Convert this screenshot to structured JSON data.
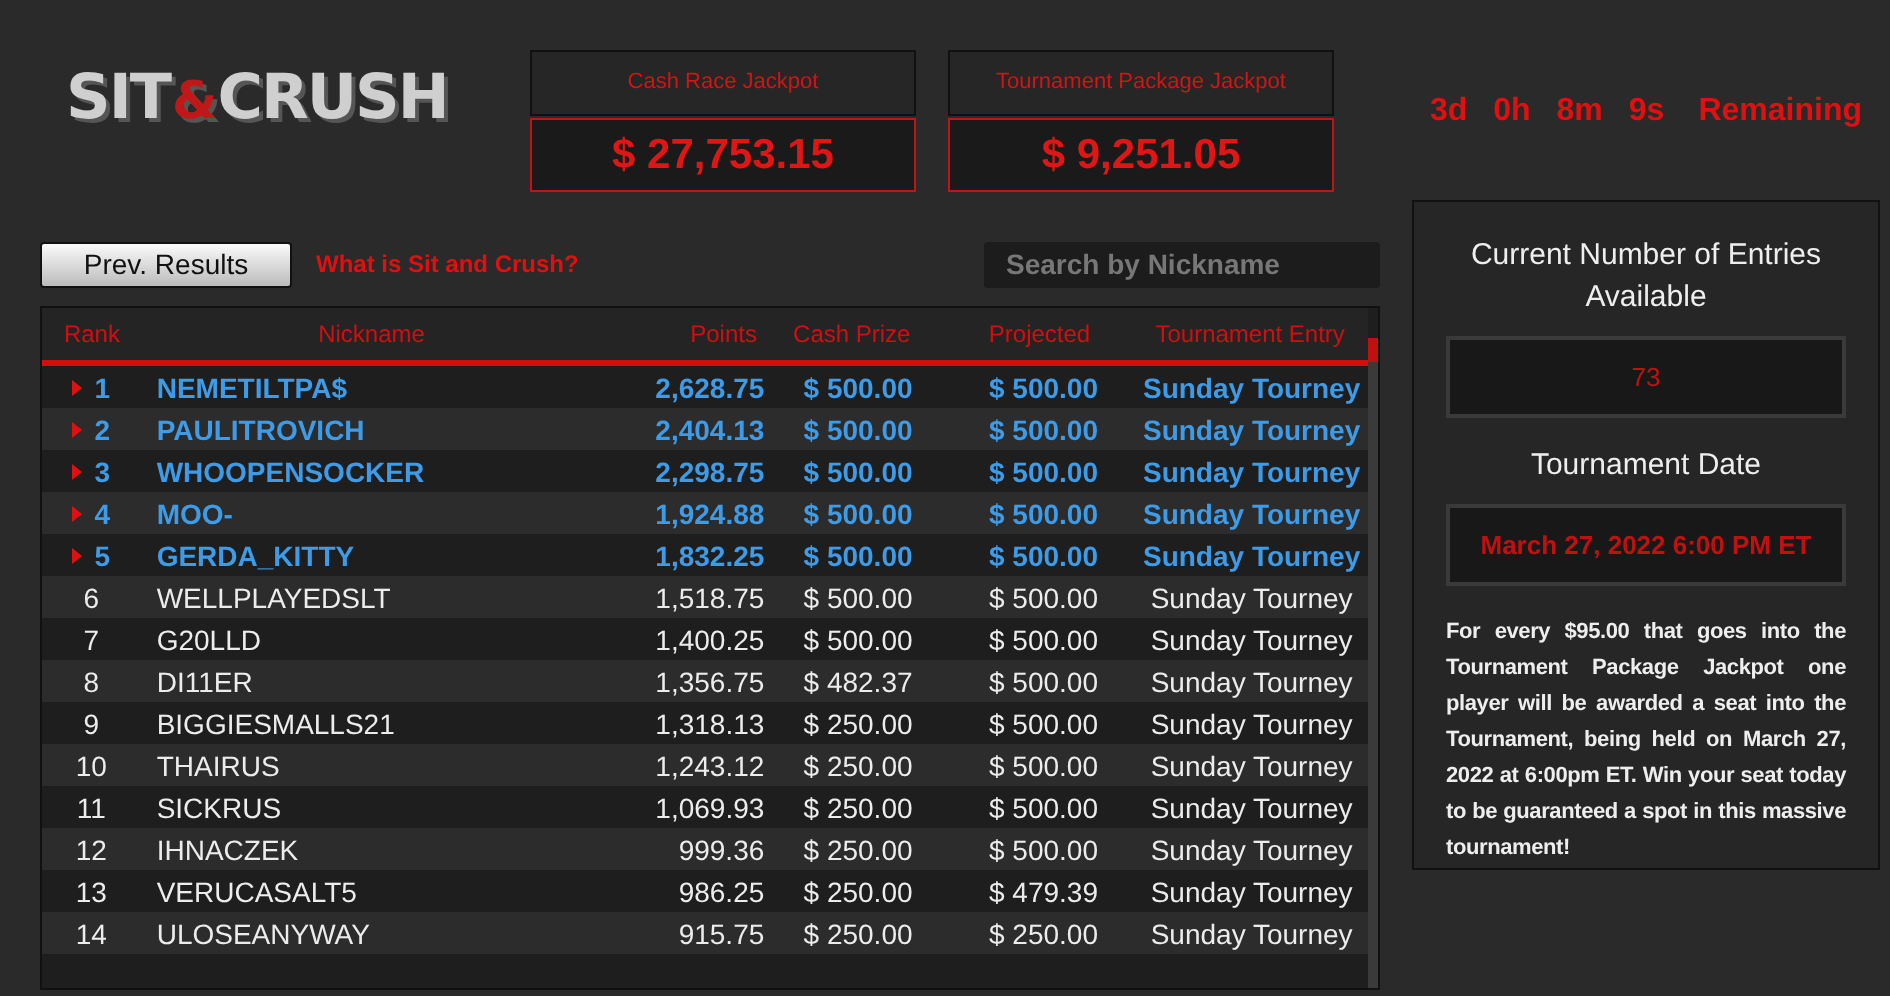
{
  "logo": {
    "parts": [
      "SIT",
      "&",
      "CRUSH"
    ]
  },
  "jackpots": [
    {
      "label": "Cash Race Jackpot",
      "amount": "$ 27,753.15"
    },
    {
      "label": "Tournament Package Jackpot",
      "amount": "$ 9,251.05"
    }
  ],
  "countdown": [
    "3d",
    "0h",
    "8m",
    "9s",
    "Remaining"
  ],
  "toolbar": {
    "button": "Prev. Results",
    "link": "What is Sit and Crush?",
    "search": {
      "placeholder": "Search by Nickname"
    }
  },
  "table": {
    "columns": [
      "Rank",
      "Nickname",
      "Points",
      "Cash Prize",
      "Projected",
      "Tournament Entry"
    ],
    "rows": [
      {
        "highlighted": true,
        "cells": [
          "1",
          "NEMETILTPA$",
          "2,628.75",
          "$ 500.00",
          "$ 500.00",
          "Sunday Tourney"
        ]
      },
      {
        "highlighted": true,
        "cells": [
          "2",
          "PAULITROVICH",
          "2,404.13",
          "$ 500.00",
          "$ 500.00",
          "Sunday Tourney"
        ]
      },
      {
        "highlighted": true,
        "cells": [
          "3",
          "WHOOPENSOCKER",
          "2,298.75",
          "$ 500.00",
          "$ 500.00",
          "Sunday Tourney"
        ]
      },
      {
        "highlighted": true,
        "cells": [
          "4",
          "MOO-",
          "1,924.88",
          "$ 500.00",
          "$ 500.00",
          "Sunday Tourney"
        ]
      },
      {
        "highlighted": true,
        "cells": [
          "5",
          "GERDA_KITTY",
          "1,832.25",
          "$ 500.00",
          "$ 500.00",
          "Sunday Tourney"
        ]
      },
      {
        "highlighted": false,
        "cells": [
          "6",
          "WELLPLAYEDSLT",
          "1,518.75",
          "$ 500.00",
          "$ 500.00",
          "Sunday Tourney"
        ]
      },
      {
        "highlighted": false,
        "cells": [
          "7",
          "G20LLD",
          "1,400.25",
          "$ 500.00",
          "$ 500.00",
          "Sunday Tourney"
        ]
      },
      {
        "highlighted": false,
        "cells": [
          "8",
          "DI11ER",
          "1,356.75",
          "$ 482.37",
          "$ 500.00",
          "Sunday Tourney"
        ]
      },
      {
        "highlighted": false,
        "cells": [
          "9",
          "BIGGIESMALLS21",
          "1,318.13",
          "$ 250.00",
          "$ 500.00",
          "Sunday Tourney"
        ]
      },
      {
        "highlighted": false,
        "cells": [
          "10",
          "THAIRUS",
          "1,243.12",
          "$ 250.00",
          "$ 500.00",
          "Sunday Tourney"
        ]
      },
      {
        "highlighted": false,
        "cells": [
          "11",
          "SICKRUS",
          "1,069.93",
          "$ 250.00",
          "$ 500.00",
          "Sunday Tourney"
        ]
      },
      {
        "highlighted": false,
        "cells": [
          "12",
          "IHNACZEK",
          "999.36",
          "$ 250.00",
          "$ 500.00",
          "Sunday Tourney"
        ]
      },
      {
        "highlighted": false,
        "cells": [
          "13",
          "VERUCASALT5",
          "986.25",
          "$ 250.00",
          "$ 479.39",
          "Sunday Tourney"
        ]
      },
      {
        "highlighted": false,
        "cells": [
          "14",
          "ULOSEANYWAY",
          "915.75",
          "$ 250.00",
          "$ 250.00",
          "Sunday Tourney"
        ]
      }
    ]
  },
  "sidebar": {
    "entries_title": "Current Number of Entries Available",
    "entries_value": "73",
    "date_title": "Tournament Date",
    "date_value": "March 27, 2022 6:00 PM ET",
    "description": "For every $95.00 that goes into the Tournament Package Jackpot one player will be awarded a seat into the Tournament, being held on March 27, 2022 at 6:00pm ET. Win your seat today to be guaranteed a spot in this massive tournament!"
  }
}
